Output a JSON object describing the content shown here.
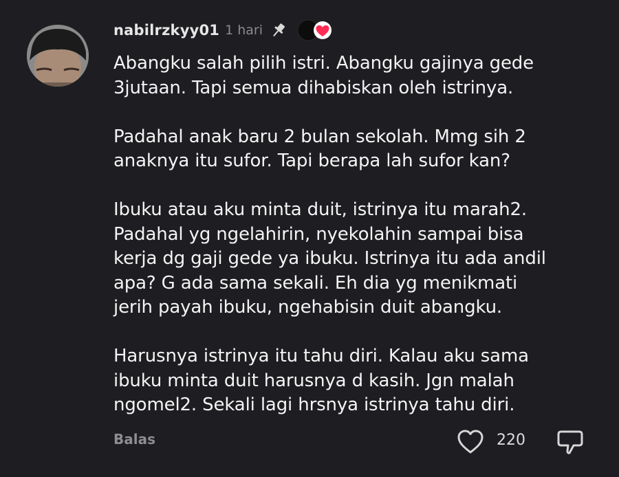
{
  "comment": {
    "username": "nabilrzkyy01",
    "time": "1 hari",
    "avatar_icon": "user-avatar-photo",
    "pinned_icon": "pin-icon",
    "creator_liked_icon": "heart-badge-icon",
    "text": "Abangku salah pilih istri. Abangku gajinya gede\n3jutaan. Tapi semua dihabiskan oleh istrinya.\n\nPadahal anak baru 2 bulan sekolah. Mmg sih 2\nanaknya itu sufor. Tapi berapa lah sufor kan?\n\nIbuku atau aku minta duit, istrinya itu marah2.\nPadahal yg ngelahirin, nyekolahin sampai bisa\nkerja dg gaji gede ya ibuku. Istrinya itu ada andil\napa? G ada sama sekali. Eh dia yg menikmati\njerih payah ibuku, ngehabisin duit abangku.\n\nHarusnya istrinya itu tahu diri. Kalau aku sama\nibuku minta duit harusnya d kasih. Jgn malah\nngomel2. Sekali lagi hrsnya istrinya tahu diri.",
    "reply_label": "Balas",
    "like_count": "220",
    "like_icon": "heart-outline-icon",
    "dislike_icon": "dislike-icon"
  },
  "colors": {
    "background": "#1e1e22",
    "text": "#f4f4f4",
    "muted": "#8d8d92",
    "heart_red": "#fe2c55"
  }
}
